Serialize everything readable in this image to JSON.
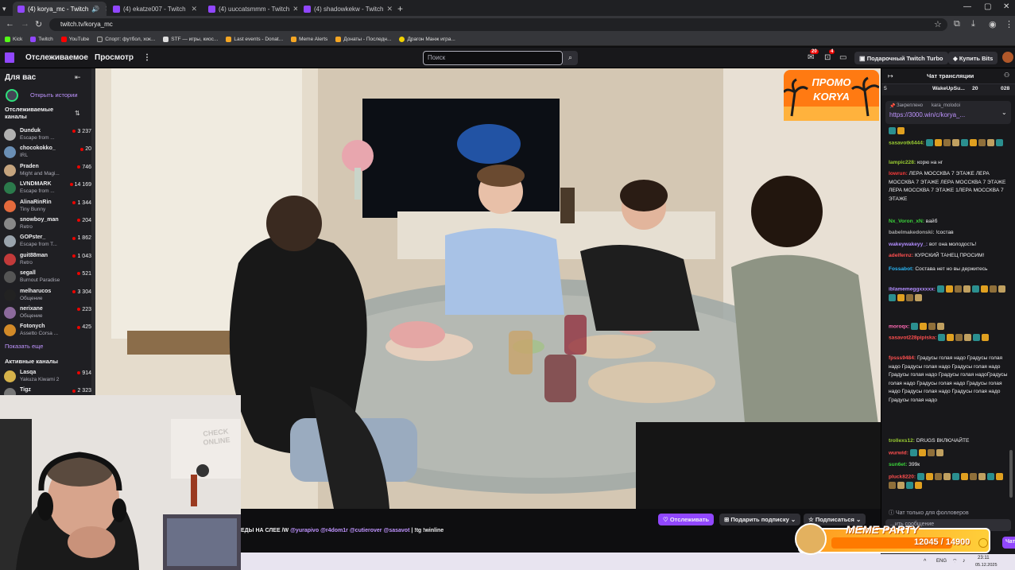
{
  "browser": {
    "tabs": [
      {
        "label": "(4) korya_mc - Twitch",
        "active": true
      },
      {
        "label": "(4) ekatze007 - Twitch",
        "active": false
      },
      {
        "label": "(4) uuccatsmmm - Twitch",
        "active": false
      },
      {
        "label": "(4) shadowkekw - Twitch",
        "active": false
      }
    ],
    "url": "twitch.tv/korya_mc",
    "bookmarks": [
      "Kick",
      "Twitch",
      "YouTube",
      "Спорт: футбол, хок...",
      "STF — игры, киос...",
      "Last events - Donat...",
      "Meme Alerts",
      "Донаты - Последн...",
      "Драгон Манж игра..."
    ]
  },
  "topnav": {
    "following": "Отслеживаемое",
    "browse": "Просмотр",
    "more": "⋮",
    "search_placeholder": "Поиск",
    "notif_count_1": "20",
    "notif_count_2": "4",
    "turbo_label": "Подарочный Twitch Turbo",
    "bits_label": "Купить Bits"
  },
  "sidebar": {
    "header": "Для вас",
    "stories": "Открыть истории",
    "followed_header": "Отслеживаемые каналы",
    "show_more": "Показать еще",
    "active_header": "Активные каналы",
    "channels": [
      {
        "name": "Dunduk",
        "game": "Escape from ...",
        "viewers": "3 237",
        "color": "#b0b0b0"
      },
      {
        "name": "chocokokko_",
        "game": "IRL",
        "viewers": "20",
        "color": "#6a8fb5"
      },
      {
        "name": "Praden",
        "game": "Might and Magi...",
        "viewers": "746",
        "color": "#c5a47e"
      },
      {
        "name": "LVNDMARK",
        "game": "Escape from ...",
        "viewers": "14 169",
        "color": "#2b7a4b"
      },
      {
        "name": "AlinaRinRin",
        "game": "Tiny Bunny",
        "viewers": "1 344",
        "color": "#e46a3c"
      },
      {
        "name": "snowboy_man",
        "game": "Retro",
        "viewers": "204",
        "color": "#888888"
      },
      {
        "name": "GOPster_",
        "game": "Escape from T...",
        "viewers": "1 862",
        "color": "#9aa4ad"
      },
      {
        "name": "guit88man",
        "game": "Retro",
        "viewers": "1 043",
        "color": "#c23a3a"
      },
      {
        "name": "segall",
        "game": "Burnout Paradise",
        "viewers": "521",
        "color": "#555"
      },
      {
        "name": "melharucos",
        "game": "Общение",
        "viewers": "3 304",
        "color": "#222"
      },
      {
        "name": "nerixane",
        "game": "Общение",
        "viewers": "223",
        "color": "#8c6a9c"
      },
      {
        "name": "Fotonych",
        "game": "Assetto Corsa ...",
        "viewers": "425",
        "color": "#d28a28"
      }
    ],
    "active_channels": [
      {
        "name": "Lasqa",
        "game": "Yakuza Kiwami 2",
        "viewers": "914",
        "color": "#d6b24a"
      },
      {
        "name": "Tigz",
        "game": "",
        "viewers": "2 323",
        "color": "#777"
      }
    ]
  },
  "video": {
    "promo_line1": "ПРОМО",
    "promo_line2": "KORYA"
  },
  "stream_info": {
    "ticker_text": "ЕДЫ НА СЛЕЕ /W",
    "mentions": [
      "@yurapivo",
      "@r4dom1r",
      "@cutierover",
      "@sasavot"
    ],
    "ticker_tail": "| !tg !winline",
    "follow_button": "Отслеживать",
    "gift_button": "Подарить подписку",
    "subscribe_button": "Подписаться"
  },
  "chat": {
    "title": "Чат трансляции",
    "topbar_user": "WakeUpSu...",
    "topbar_count": "20",
    "topbar_count2": "028",
    "pinned_label": "Закреплено",
    "pinned_by": "kara_molodoi",
    "pinned_link": "https://3000.win/c/korya_...",
    "messages": [
      {
        "user": "",
        "text": "",
        "user_color": "#ffffff"
      },
      {
        "user": "sasavotk6444:",
        "text": "",
        "user_color": "#9acd32"
      },
      {
        "user": "lampic228:",
        "text": "корю на нг",
        "user_color": "#9acd32"
      },
      {
        "user": "lowrun:",
        "text": "ЛЕРА МОССКВА 7 ЭТАЖЕ ЛЕРА МОССКВА 7 ЭТАЖЕ ЛЕРА МОССКВА 7 ЭТАЖЕ ЛЕРА МОССКВА 7 ЭТАЖЕ 1ЛЕРА МОССКВА 7 ЭТАЖЕ",
        "user_color": "#ff3b3b"
      },
      {
        "user": "Nx_Voron_xN:",
        "text": "вайб",
        "user_color": "#3bd13b"
      },
      {
        "user": "babelmakedonski:",
        "text": "!состав",
        "user_color": "#a6a6a6"
      },
      {
        "user": "wakeywakeyy_:",
        "text": "вот она молодость!",
        "user_color": "#b28dff"
      },
      {
        "user": "adelfernz:",
        "text": "КУРСКИЙ ТАНЕЦ ПРОСИМ!",
        "user_color": "#ff4f4f"
      },
      {
        "user": "Fossabot:",
        "text": "Состава нет но вы держитесь",
        "user_color": "#29b6f6"
      },
      {
        "user": "iblamemeggxxxxx:",
        "text": "",
        "user_color": "#b28dff"
      },
      {
        "user": "moroqx:",
        "text": "",
        "user_color": "#ff69b4"
      },
      {
        "user": "sasavot228pipiska:",
        "text": "",
        "user_color": "#ff4f4f"
      },
      {
        "user": "fpsss9484:",
        "text": "Градусы голая надо Градусы голая надо Градусы голая надо Градусы голая надо Градусы голая надо Градусы голая надоГрадусы голая надо Градусы голая надо Градусы голая надо Градусы голая надо Градусы голая надо Градусы голая надо",
        "user_color": "#ff4f4f"
      },
      {
        "user": "trollexs12:",
        "text": "DRUGS ВКЛЮЧАЙТЕ",
        "user_color": "#9acd32"
      },
      {
        "user": "wurwid:",
        "text": "",
        "user_color": "#ff4f4f"
      },
      {
        "user": "sun6et:",
        "text": "399к",
        "user_color": "#3bd13b"
      },
      {
        "user": "pluck8220:",
        "text": "",
        "user_color": "#ff4f4f"
      }
    ],
    "followers_only": "Чат только для фолловеров",
    "input_placeholder": "...ить сообщение",
    "chat_button": "Чат"
  },
  "overlay": {
    "meme_party": "MEME PARTY",
    "progress_text": "12045 / 14900",
    "progress_value": 0.8084
  },
  "taskbar": {
    "lang": "ENG",
    "time": "23:11",
    "date": "05.12.2025"
  },
  "webcam": {
    "sign_text": "CHECK ONLINE"
  }
}
